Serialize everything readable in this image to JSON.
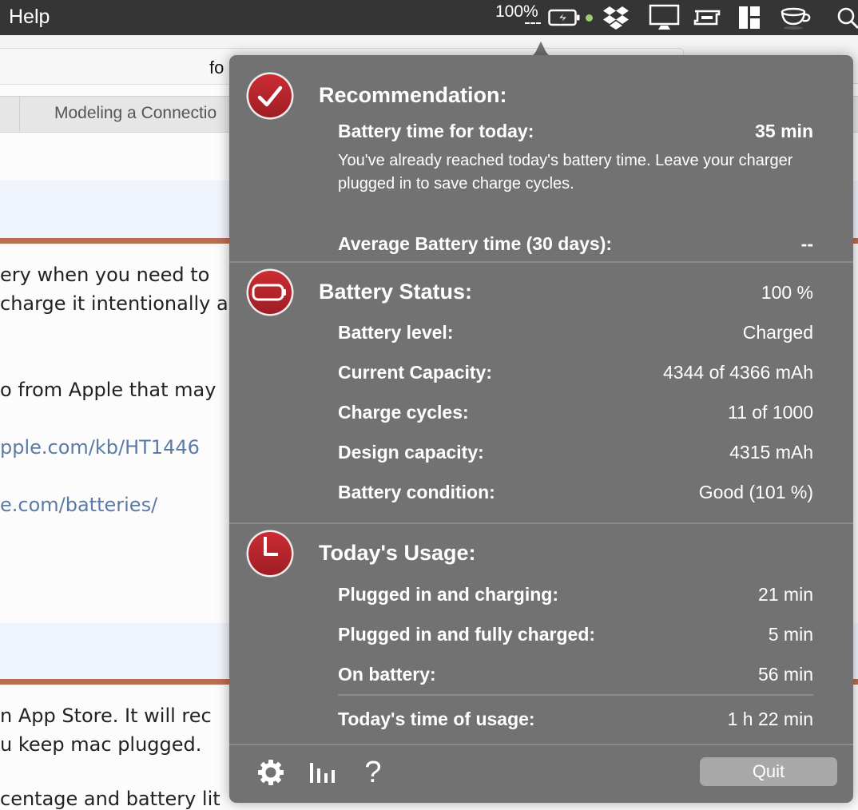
{
  "menubar": {
    "app_menu_label": "Help",
    "battery_percent": "100%",
    "status_icons": [
      "battery-charging-icon",
      "status-dot-icon",
      "dropbox-icon",
      "display-icon",
      "window-manager-icon",
      "layout-icon",
      "coffee-cup-icon",
      "spotlight-search-icon"
    ],
    "status_dot_color": "#9dcc6b"
  },
  "browser": {
    "url_text": "fo",
    "tab_title": "Modeling a Connectio"
  },
  "page": {
    "lines": [
      {
        "text": "ery when you need to"
      },
      {
        "text": "charge it intentionally a"
      },
      {
        "text": "o from Apple that may"
      },
      {
        "text": "pple.com/kb/HT1446",
        "link": true
      },
      {
        "text": "e.com/batteries/",
        "link": true
      },
      {
        "text": "n App Store. It will rec"
      },
      {
        "text": "u keep mac plugged."
      },
      {
        "text": "centage and battery lit"
      }
    ],
    "rule_color": "#b96e53",
    "band_color": "#eff3fb",
    "link_color": "#5b7aa6"
  },
  "popover": {
    "accent_color": "#b3242a",
    "recommendation": {
      "title": "Recommendation:",
      "icon": "checkmark-icon",
      "battery_time_label": "Battery time for today:",
      "battery_time_value": "35 min",
      "description": "You've already reached today's battery time. Leave your charger plugged in to save charge cycles.",
      "average_label": "Average Battery time (30 days):",
      "average_value": "--"
    },
    "battery_status": {
      "title": "Battery Status:",
      "icon": "battery-icon",
      "percent": "100 %",
      "rows": [
        {
          "label": "Battery level:",
          "value": "Charged"
        },
        {
          "label": "Current Capacity:",
          "value": "4344 of 4366 mAh"
        },
        {
          "label": "Charge cycles:",
          "value": "11 of 1000"
        },
        {
          "label": "Design capacity:",
          "value": "4315 mAh"
        },
        {
          "label": "Battery condition:",
          "value": "Good (101 %)"
        }
      ]
    },
    "usage": {
      "title": "Today's Usage:",
      "icon": "clock-icon",
      "rows": [
        {
          "label": "Plugged in and charging:",
          "value": "21 min"
        },
        {
          "label": "Plugged in and fully charged:",
          "value": "5 min"
        },
        {
          "label": "On battery:",
          "value": "56 min"
        }
      ],
      "total_label": "Today's time of usage:",
      "total_value": "1 h 22 min"
    },
    "footer": {
      "icons": [
        "gear-icon",
        "bar-chart-icon",
        "help-icon"
      ],
      "help_glyph": "?",
      "quit_label": "Quit"
    }
  }
}
